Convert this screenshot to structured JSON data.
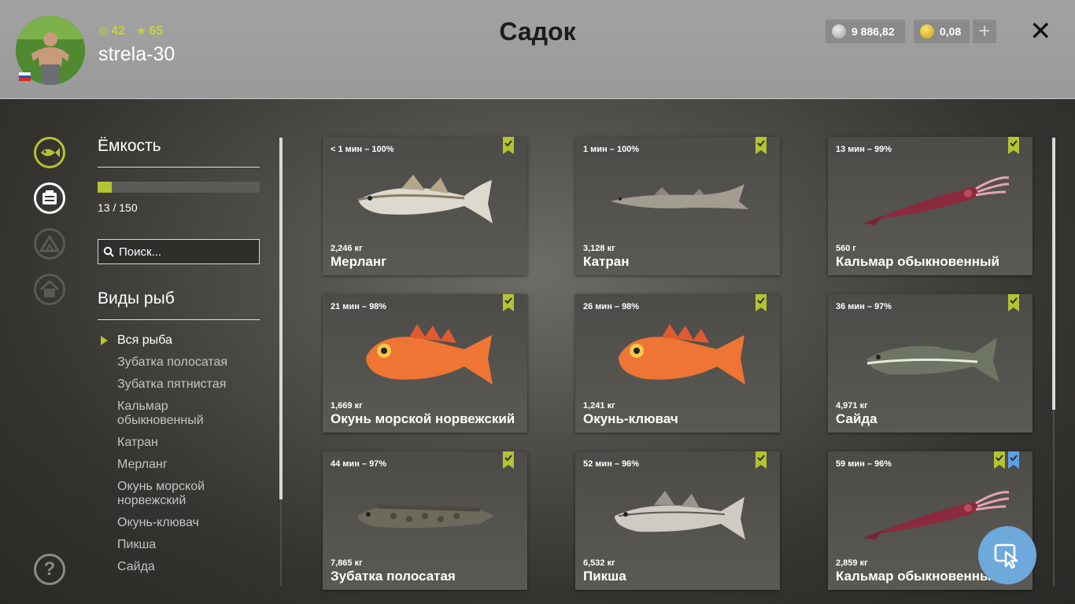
{
  "header": {
    "title": "Садок",
    "username": "strela-30",
    "level": "42",
    "stars": "65",
    "silver": "9 886,82",
    "gold": "0,08",
    "plus_label": "+",
    "close_label": "✕"
  },
  "sidebar": {
    "capacity_title": "Ёмкость",
    "capacity_text": "13 / 150",
    "capacity_fraction": 0.087,
    "search_placeholder": "Поиск...",
    "species_title": "Виды рыб",
    "species": [
      "Вся рыба",
      "Зубатка полосатая",
      "Зубатка пятнистая",
      "Кальмар обыкновенный",
      "Катран",
      "Мерланг",
      "Окунь морской норвежский",
      "Окунь-клювач",
      "Пикша",
      "Сайда"
    ]
  },
  "cards": [
    {
      "time": "< 1 мин – 100%",
      "weight": "2,246 кг",
      "name": "Мерланг",
      "icon": "whiting"
    },
    {
      "time": "1 мин – 100%",
      "weight": "3,128 кг",
      "name": "Катран",
      "icon": "dogfish"
    },
    {
      "time": "13 мин – 99%",
      "weight": "560 г",
      "name": "Кальмар обыкновенный",
      "icon": "squid"
    },
    {
      "time": "21 мин – 98%",
      "weight": "1,669 кг",
      "name": "Окунь морской норвежский",
      "icon": "redfish"
    },
    {
      "time": "26 мин – 98%",
      "weight": "1,241 кг",
      "name": "Окунь-клювач",
      "icon": "redfish"
    },
    {
      "time": "36 мин – 97%",
      "weight": "4,971 кг",
      "name": "Сайда",
      "icon": "pollock"
    },
    {
      "time": "44 мин – 97%",
      "weight": "7,865 кг",
      "name": "Зубатка полосатая",
      "icon": "wolffish"
    },
    {
      "time": "52 мин – 96%",
      "weight": "6,532 кг",
      "name": "Пикша",
      "icon": "haddock"
    },
    {
      "time": "59 мин – 96%",
      "weight": "2,859 кг",
      "name": "Кальмар обыкновенный",
      "icon": "squid"
    }
  ],
  "colors": {
    "accent": "#b2c430",
    "badge_blue": "#5aa0e6",
    "fab": "#6ea9dc"
  }
}
